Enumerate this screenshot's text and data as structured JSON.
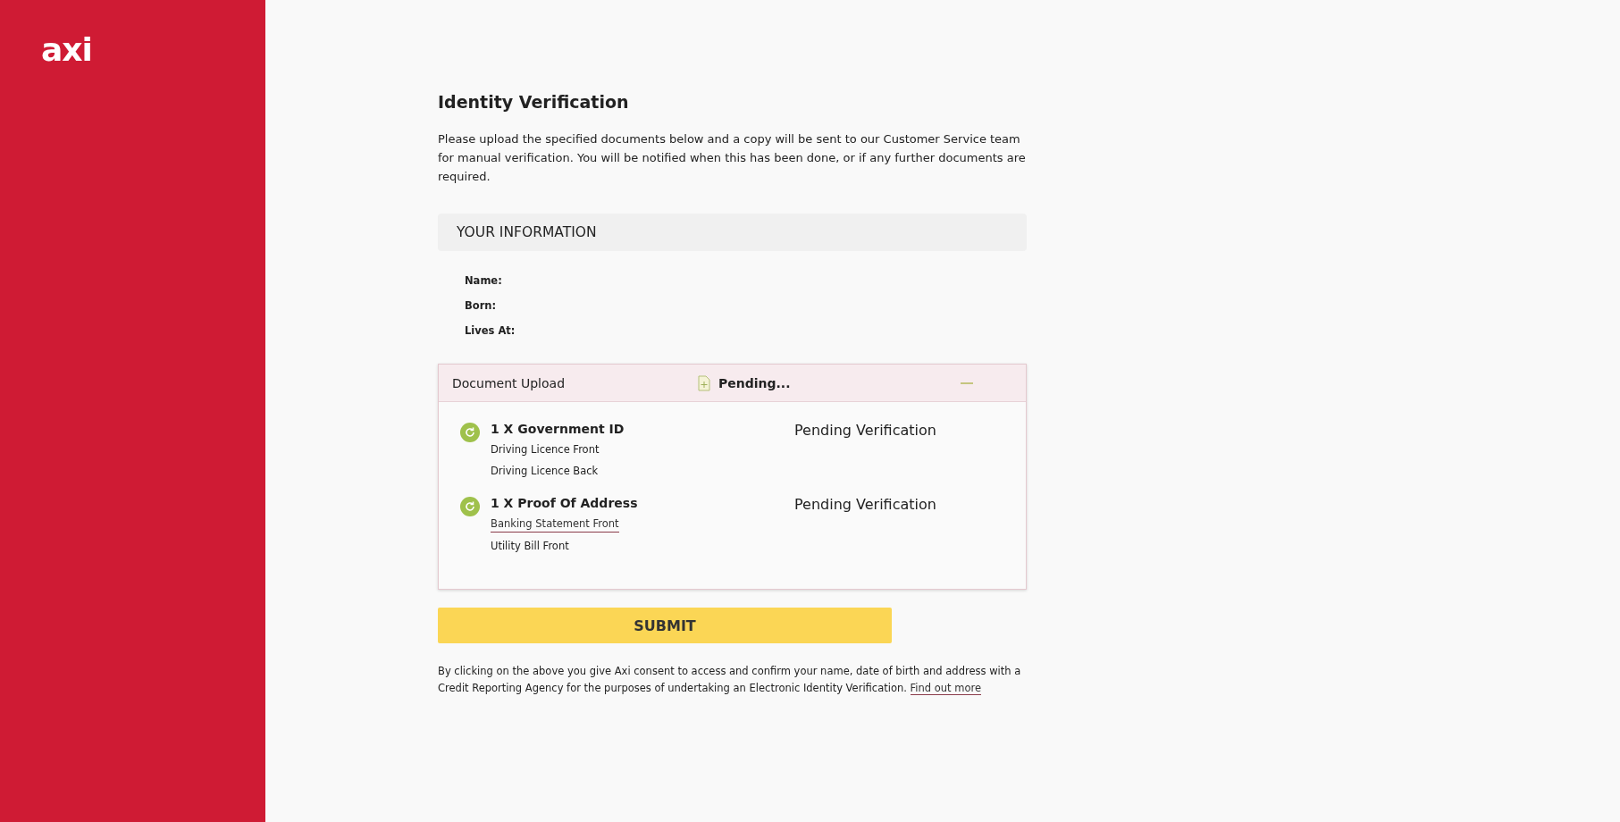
{
  "sidebar": {
    "logo": "axi"
  },
  "title": "Identity Verification",
  "intro": "Please upload the specified documents below and a copy will be sent to our Customer Service team for manual verification. You will be notified when this has been done, or if any further documents are required.",
  "your_information": {
    "heading": "YOUR INFORMATION",
    "fields": [
      {
        "label": "Name:"
      },
      {
        "label": "Born:"
      },
      {
        "label": "Lives At:"
      }
    ]
  },
  "document_upload": {
    "label": "Document Upload",
    "status": "Pending...",
    "expanded": true,
    "requirements": [
      {
        "title": "1 X Government ID",
        "status": "Pending Verification",
        "documents": [
          {
            "name": "Driving Licence Front",
            "kind": "text"
          },
          {
            "name": "Driving Licence Back",
            "kind": "text"
          }
        ]
      },
      {
        "title": "1 X Proof Of Address",
        "status": "Pending Verification",
        "documents": [
          {
            "name": "Banking Statement  Front",
            "kind": "link"
          },
          {
            "name": "Utility Bill Front",
            "kind": "text"
          }
        ]
      }
    ]
  },
  "submit": "SUBMIT",
  "consent": {
    "text": "By clicking on the above you give Axi consent to access and confirm your name, date of birth and address with a Credit Reporting Agency for the purposes of undertaking an Electronic Identity Verification.",
    "link": "Find out more"
  }
}
